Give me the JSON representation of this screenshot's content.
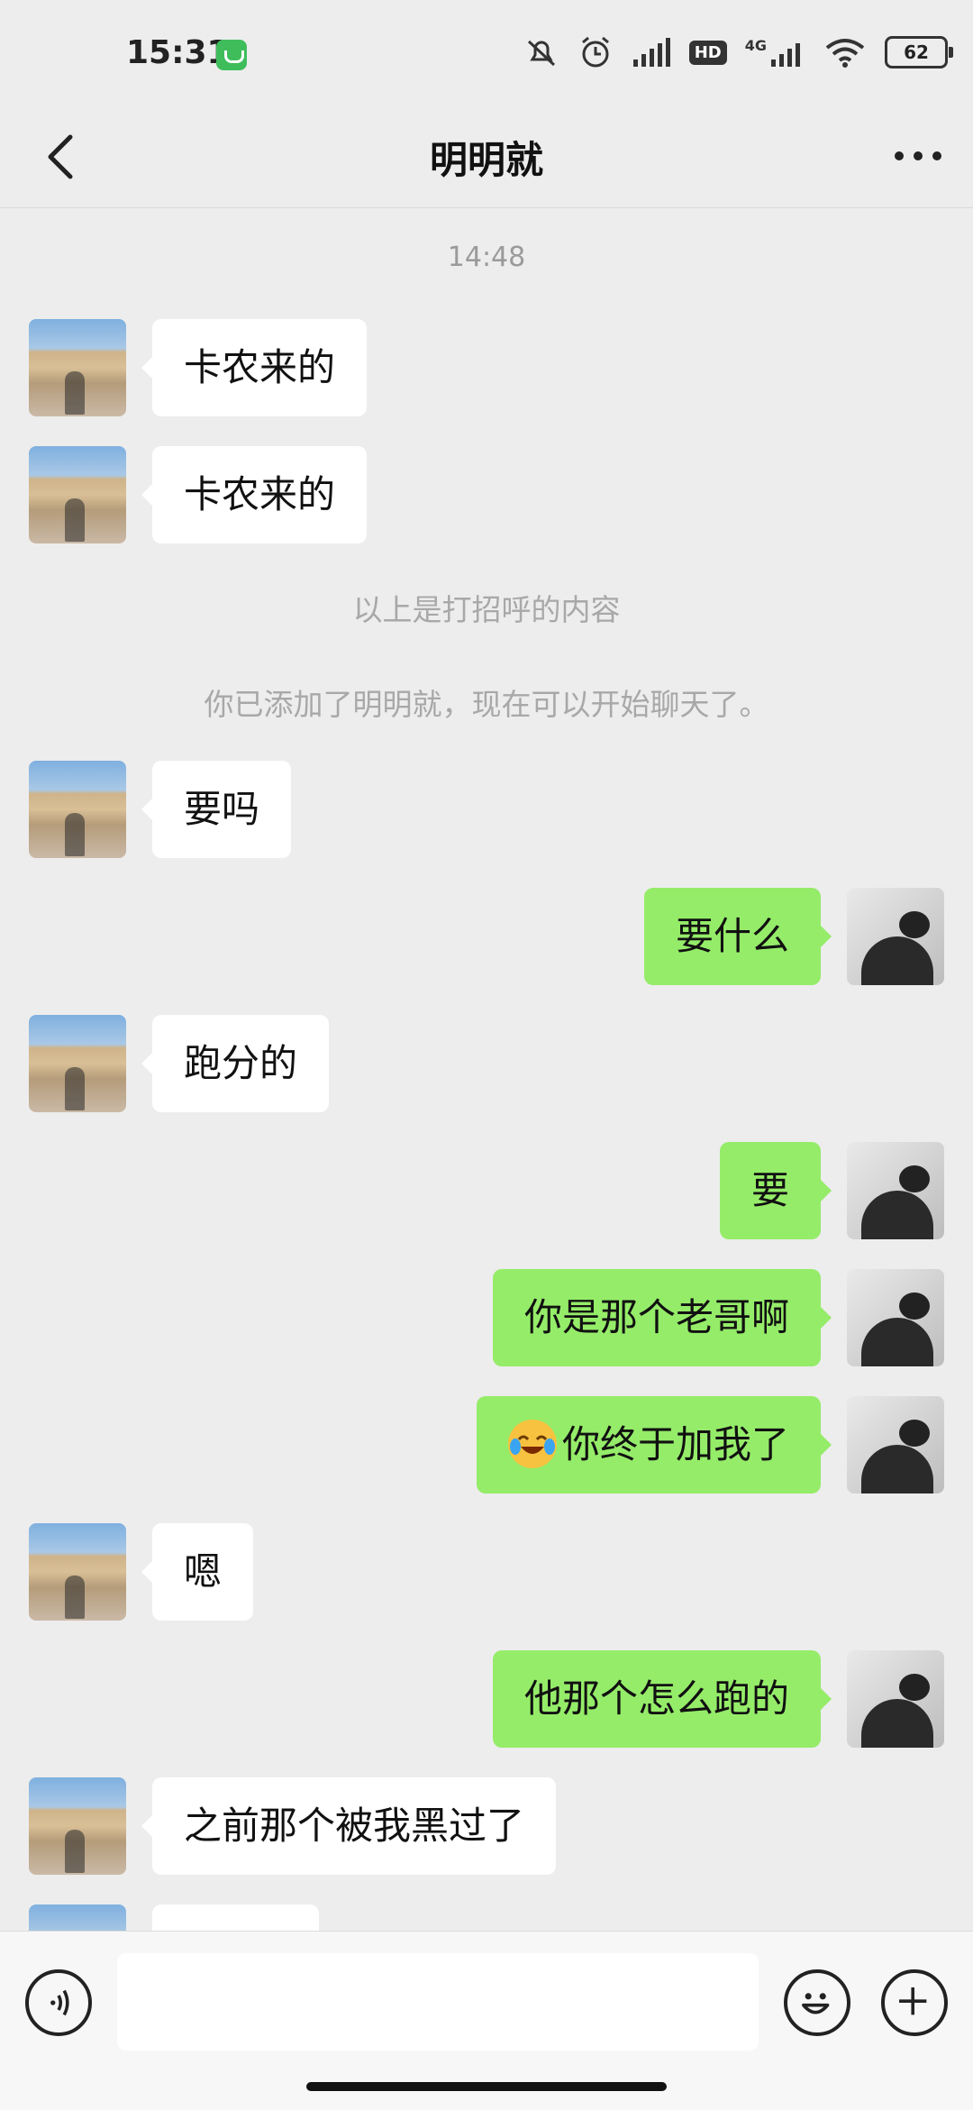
{
  "status_bar": {
    "time": "15:31",
    "network": "4G",
    "hd": "HD",
    "battery": "62",
    "icons": [
      "mute-icon",
      "alarm-icon",
      "signal-icon",
      "hd-icon",
      "4g-signal-icon",
      "wifi-icon",
      "battery-icon"
    ]
  },
  "header": {
    "title": "明明就",
    "back_icon": "chevron-left-icon",
    "more_icon": "more-dots-icon"
  },
  "messages": [
    {
      "type": "time",
      "text": "14:48"
    },
    {
      "type": "msg",
      "side": "left",
      "text": "卡农来的"
    },
    {
      "type": "msg",
      "side": "left",
      "text": "卡农来的"
    },
    {
      "type": "system",
      "text": "以上是打招呼的内容"
    },
    {
      "type": "system",
      "text": "你已添加了明明就，现在可以开始聊天了。"
    },
    {
      "type": "msg",
      "side": "left",
      "text": "要吗"
    },
    {
      "type": "msg",
      "side": "right",
      "text": "要什么"
    },
    {
      "type": "msg",
      "side": "left",
      "text": "跑分的"
    },
    {
      "type": "msg",
      "side": "right",
      "text": "要"
    },
    {
      "type": "msg",
      "side": "right",
      "text": "你是那个老哥啊"
    },
    {
      "type": "msg",
      "side": "right",
      "text": "你终于加我了",
      "emoji": "laughing-crying-emoji"
    },
    {
      "type": "msg",
      "side": "left",
      "text": "嗯"
    },
    {
      "type": "msg",
      "side": "right",
      "text": "他那个怎么跑的"
    },
    {
      "type": "msg",
      "side": "left",
      "text": "之前那个被我黑过了"
    }
  ],
  "input_bar": {
    "voice_icon": "voice-icon",
    "input_value": "",
    "emoji_icon": "emoji-icon",
    "plus_icon": "plus-icon"
  },
  "colors": {
    "background": "#ededed",
    "sent_bubble": "#95ec69",
    "received_bubble": "#ffffff"
  }
}
